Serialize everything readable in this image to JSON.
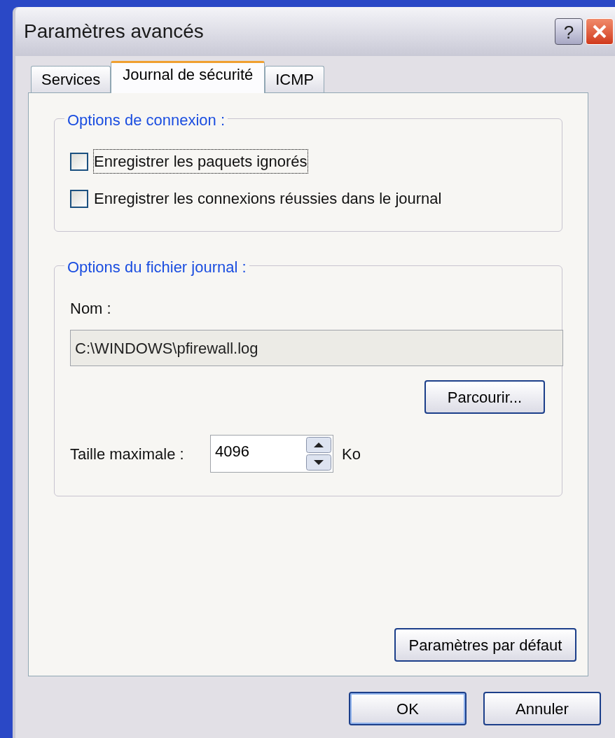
{
  "window": {
    "title": "Paramètres avancés",
    "help": "?"
  },
  "tabs": [
    {
      "label": "Services",
      "selected": false
    },
    {
      "label": "Journal de sécurité",
      "selected": true
    },
    {
      "label": "ICMP",
      "selected": false
    }
  ],
  "connection_options": {
    "title": "Options de connexion :",
    "checkboxes": [
      {
        "label": "Enregistrer les paquets ignorés",
        "checked": false,
        "focused": true
      },
      {
        "label": "Enregistrer les connexions réussies dans le journal",
        "checked": false,
        "focused": false
      }
    ]
  },
  "log_file_options": {
    "title": "Options du fichier journal :",
    "name_label": "Nom :",
    "name_value": "C:\\WINDOWS\\pfirewall.log",
    "browse_button": "Parcourir...",
    "size_label": "Taille maximale :",
    "size_value": "4096",
    "size_unit": "Ko"
  },
  "default_button": "Paramètres par défaut",
  "buttons": [
    {
      "label": "OK",
      "default": true
    },
    {
      "label": "Annuler",
      "default": false
    }
  ]
}
